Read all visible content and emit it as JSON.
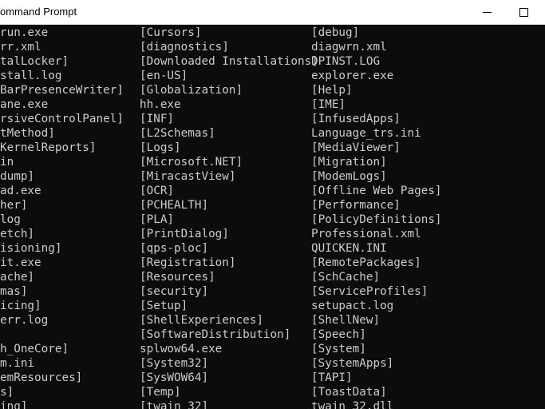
{
  "window": {
    "title": "ommand Prompt"
  },
  "columns": [
    [
      "run.exe",
      "rr.xml",
      "talLocker]",
      "stall.log",
      "BarPresenceWriter]",
      "ane.exe",
      "rsiveControlPanel]",
      "tMethod]",
      "KernelReports]",
      "in",
      "dump]",
      "ad.exe",
      "her]",
      "log",
      "etch]",
      "isioning]",
      "it.exe",
      "ache]",
      "mas]",
      "icing]",
      "err.log",
      "",
      "h_OneCore]",
      "m.ini",
      "emResources]",
      "s]",
      "ing]"
    ],
    [
      "[Cursors]",
      "[diagnostics]",
      "[Downloaded Installations]",
      "[en-US]",
      "[Globalization]",
      "hh.exe",
      "[INF]",
      "[L2Schemas]",
      "[Logs]",
      "[Microsoft.NET]",
      "[MiracastView]",
      "[OCR]",
      "[PCHEALTH]",
      "[PLA]",
      "[PrintDialog]",
      "[qps-ploc]",
      "[Registration]",
      "[Resources]",
      "[security]",
      "[Setup]",
      "[ShellExperiences]",
      "[SoftwareDistribution]",
      "splwow64.exe",
      "[System32]",
      "[SysWOW64]",
      "[Temp]",
      "[twain_32]"
    ],
    [
      "[debug]",
      "diagwrn.xml",
      "DPINST.LOG",
      "explorer.exe",
      "[Help]",
      "[IME]",
      "[InfusedApps]",
      "Language_trs.ini",
      "[MediaViewer]",
      "[Migration]",
      "[ModemLogs]",
      "[Offline Web Pages]",
      "[Performance]",
      "[PolicyDefinitions]",
      "Professional.xml",
      "QUICKEN.INI",
      "[RemotePackages]",
      "[SchCache]",
      "[ServiceProfiles]",
      "setupact.log",
      "[ShellNew]",
      "[Speech]",
      "[System]",
      "[SystemApps]",
      "[TAPI]",
      "[ToastData]",
      "twain_32.dll"
    ]
  ]
}
